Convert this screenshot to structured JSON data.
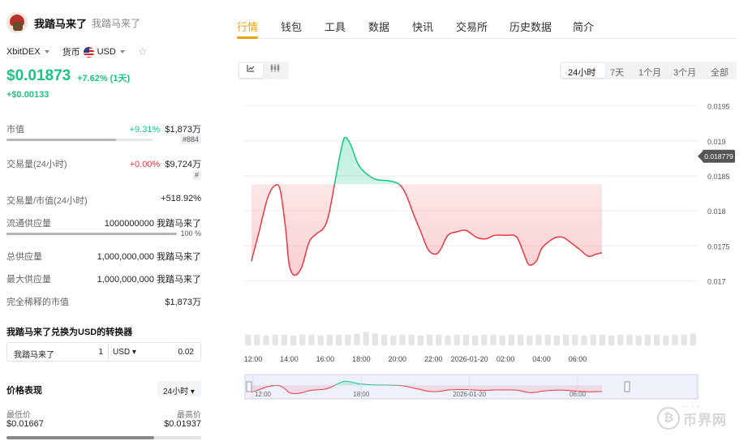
{
  "coin": {
    "name": "我踏马来了",
    "subtitle": "我踏马来了",
    "exchange": "XbitDEX",
    "currency_label": "货币",
    "currency": "USD",
    "price": "$0.01873",
    "change": "+7.62% (1天)",
    "change_abs": "+$0.00133"
  },
  "stats": {
    "market_cap": {
      "label": "市值",
      "change": "+9.31%",
      "value": "$1,873万",
      "rank": "#884",
      "progress": 0.75
    },
    "volume": {
      "label": "交易量(24小时)",
      "change": "+0.00%",
      "value": "$9,724万",
      "rank": "#"
    },
    "vol_mcap": {
      "label": "交易量/市值(24小时)",
      "value": "+518.92%"
    },
    "circulating": {
      "label": "流通供应量",
      "value": "1000000000 我踏马来了",
      "percent": "100 %",
      "progress": 1.0
    },
    "total_supply": {
      "label": "总供应量",
      "value": "1,000,000,000 我踏马来了"
    },
    "max_supply": {
      "label": "最大供应量",
      "value": "1,000,000,000 我踏马来了"
    },
    "fdv": {
      "label": "完全稀释的市值",
      "value": "$1,873万"
    }
  },
  "converter": {
    "title": "我踏马来了兑换为USD的转换器",
    "from_symbol": "我踏马来了",
    "from_amount": "1",
    "to_currency": "USD ▾",
    "to_amount": "0.02"
  },
  "performance": {
    "title": "价格表现",
    "range": "24小时 ▾",
    "low_label": "最低价",
    "low_value": "$0.01667",
    "high_label": "最高价",
    "high_value": "$0.01937",
    "position": 0.76
  },
  "tabs": [
    "行情",
    "钱包",
    "工具",
    "数据",
    "快讯",
    "交易所",
    "历史数据",
    "简介"
  ],
  "active_tab": 0,
  "time_ranges": [
    "24小时",
    "7天",
    "1个月",
    "3个月",
    "全部"
  ],
  "active_range": 0,
  "chart_data": {
    "type": "area",
    "x_tick_labels": [
      "12:00",
      "14:00",
      "16:00",
      "18:00",
      "20:00",
      "22:00",
      "2026-01-20",
      "02:00",
      "04:00",
      "06:00"
    ],
    "x_tick_hours": [
      0,
      2,
      4,
      6,
      8,
      10,
      12,
      14,
      16,
      18
    ],
    "navigator_labels": [
      "12:00",
      "18:00",
      "2026-01-20",
      "06:00"
    ],
    "navigator_hours": [
      0,
      6,
      12,
      18
    ],
    "y_ticks": [
      0.017,
      0.0175,
      0.018,
      0.0185,
      0.019,
      0.0195
    ],
    "ylim": [
      0.01675,
      0.0196
    ],
    "baseline": 0.01838,
    "current_label": "0.018779",
    "current_value": 0.01878,
    "colors": {
      "up": "#16c784",
      "down": "#ea3943"
    },
    "series": [
      {
        "hours": [
          -0.1,
          0.3,
          0.8,
          1.2,
          1.5,
          1.8,
          2.0,
          2.3,
          2.7,
          3.1,
          3.5,
          3.9,
          4.2,
          4.6,
          4.9,
          5.1,
          5.4,
          5.8,
          6.2,
          6.8,
          7.5,
          8.1,
          8.5,
          8.9,
          9.3,
          9.7,
          10.1,
          10.4,
          10.8,
          11.3,
          11.8,
          12.4,
          12.9,
          13.4,
          14.0,
          14.6,
          15.0,
          15.3,
          15.7,
          16.0,
          16.4,
          16.8,
          17.2,
          17.6,
          18.1,
          18.6,
          19.0,
          19.35
        ],
        "values": [
          0.01728,
          0.01767,
          0.01818,
          0.01836,
          0.0183,
          0.01775,
          0.01723,
          0.01708,
          0.0172,
          0.01755,
          0.01767,
          0.01775,
          0.01795,
          0.0185,
          0.0189,
          0.01905,
          0.01895,
          0.01868,
          0.01855,
          0.01845,
          0.01843,
          0.01838,
          0.01822,
          0.01795,
          0.0177,
          0.01745,
          0.01738,
          0.01745,
          0.01765,
          0.0177,
          0.01772,
          0.01762,
          0.0176,
          0.01765,
          0.01765,
          0.01763,
          0.0174,
          0.01723,
          0.01728,
          0.01746,
          0.01756,
          0.01762,
          0.01762,
          0.01755,
          0.01745,
          0.01735,
          0.01738,
          0.0174
        ]
      }
    ],
    "volume": [
      0.55,
      0.55,
      0.5,
      0.55,
      0.55,
      0.5,
      0.55,
      0.55,
      0.5,
      0.55,
      0.55,
      0.55,
      0.6,
      0.7,
      0.6,
      0.55,
      0.5,
      0.55,
      0.55,
      0.5,
      0.55,
      0.55,
      0.5,
      0.55,
      0.55,
      0.5,
      0.55,
      0.55,
      0.5,
      0.55,
      0.55,
      0.5,
      0.55,
      0.55,
      0.5,
      0.55,
      0.55,
      0.5,
      0.55,
      0.55,
      0.5,
      0.55,
      0.55,
      0.5,
      0.55,
      0.55,
      0.5,
      0.55,
      0.55,
      0.6
    ],
    "watermark": "Highcharts.com.cn"
  },
  "site_watermark": {
    "glyph": "₿",
    "text": "币界网"
  }
}
